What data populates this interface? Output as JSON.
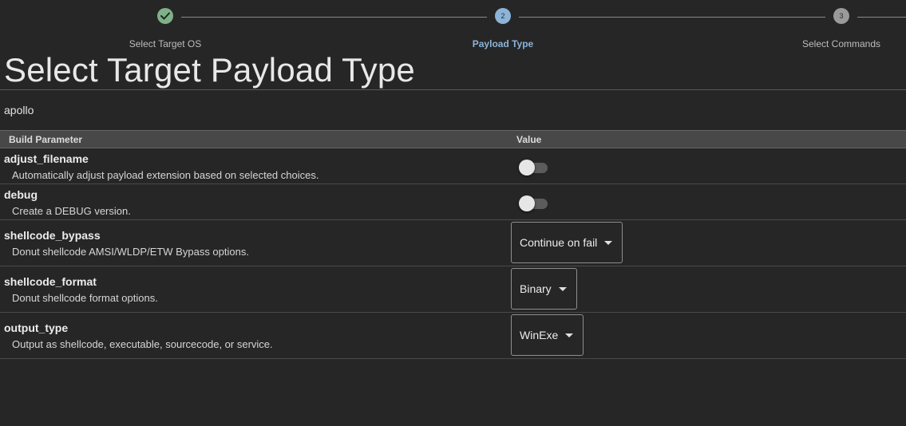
{
  "stepper": {
    "steps": [
      {
        "label": "Select Target OS",
        "number": "",
        "status": "completed"
      },
      {
        "label": "Payload Type",
        "number": "2",
        "status": "active"
      },
      {
        "label": "Select Commands",
        "number": "3",
        "status": "pending"
      }
    ]
  },
  "page_title": "Select Target Payload Type",
  "payload_type": "apollo",
  "table": {
    "headers": {
      "parameter": "Build Parameter",
      "value": "Value"
    },
    "rows": [
      {
        "name": "adjust_filename",
        "description": "Automatically adjust payload extension based on selected choices.",
        "control": "switch",
        "value": ""
      },
      {
        "name": "debug",
        "description": "Create a DEBUG version.",
        "control": "switch",
        "value": ""
      },
      {
        "name": "shellcode_bypass",
        "description": "Donut shellcode AMSI/WLDP/ETW Bypass options.",
        "control": "select",
        "value": "Continue on fail"
      },
      {
        "name": "shellcode_format",
        "description": "Donut shellcode format options.",
        "control": "select",
        "value": "Binary"
      },
      {
        "name": "output_type",
        "description": "Output as shellcode, executable, sourcecode, or service.",
        "control": "select",
        "value": "WinExe"
      }
    ]
  },
  "colors": {
    "completed": "#7fb08a",
    "active": "#8cb4d8",
    "pending": "#9a9a9a",
    "background": "#262626"
  },
  "icons": {
    "completed_step": "check-icon",
    "select_arrow": "caret-down-icon"
  }
}
